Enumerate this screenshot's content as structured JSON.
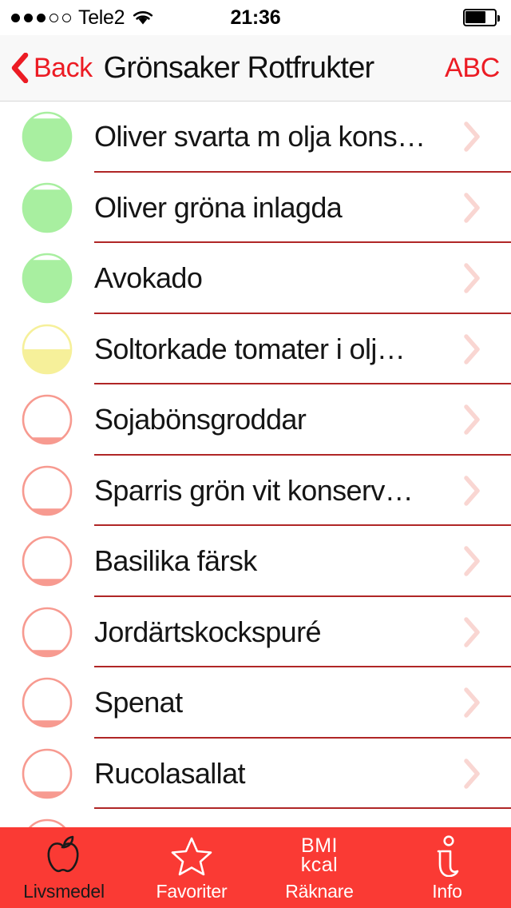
{
  "status_bar": {
    "signal_dots_filled": 3,
    "signal_dots_total": 5,
    "carrier": "Tele2",
    "wifi_icon": "wifi-icon",
    "time": "21:36",
    "battery_percent": 70,
    "battery_icon": "battery-icon"
  },
  "nav_bar": {
    "back_icon": "chevron-left-icon",
    "back_label": "Back",
    "title": "Grönsaker Rotfrukter",
    "right_button_label": "ABC"
  },
  "colors": {
    "tab_bar_red": "#FA3A34",
    "accent_red": "#EC1C24",
    "separator_red": "#B02626",
    "gauge_green": "#A8EFA0",
    "gauge_yellow": "#F6F09A",
    "gauge_pink": "#F79A90",
    "chevron_pink": "#F9D6D2",
    "active_tab_label": "#1A1A1A"
  },
  "list": {
    "chevron_icon": "chevron-right-icon",
    "gauge_icon": "fill-gauge-icon",
    "items": [
      {
        "label": "Oliver svarta m olja kons…",
        "gauge_color": "#A8EFA0",
        "gauge_fill": 88
      },
      {
        "label": "Oliver gröna inlagda",
        "gauge_color": "#A8EFA0",
        "gauge_fill": 88
      },
      {
        "label": "Avokado",
        "gauge_color": "#A8EFA0",
        "gauge_fill": 88
      },
      {
        "label": "Soltorkade tomater i olj…",
        "gauge_color": "#F6F09A",
        "gauge_fill": 50
      },
      {
        "label": "Sojabönsgroddar",
        "gauge_color": "#F79A90",
        "gauge_fill": 13
      },
      {
        "label": "Sparris grön vit konserv…",
        "gauge_color": "#F79A90",
        "gauge_fill": 13
      },
      {
        "label": "Basilika färsk",
        "gauge_color": "#F79A90",
        "gauge_fill": 13
      },
      {
        "label": "Jordärtskockspuré",
        "gauge_color": "#F79A90",
        "gauge_fill": 13
      },
      {
        "label": "Spenat",
        "gauge_color": "#F79A90",
        "gauge_fill": 13
      },
      {
        "label": "Rucolasallat",
        "gauge_color": "#F79A90",
        "gauge_fill": 13
      },
      {
        "label": "",
        "gauge_color": "#F79A90",
        "gauge_fill": 13
      }
    ]
  },
  "tab_bar": {
    "tabs": [
      {
        "label": "Livsmedel",
        "icon": "apple-icon",
        "active": true
      },
      {
        "label": "Favoriter",
        "icon": "star-icon",
        "active": false
      },
      {
        "label": "Räknare",
        "icon": "bmi-kcal-icon",
        "active": false,
        "icon_line1": "BMI",
        "icon_line2": "kcal"
      },
      {
        "label": "Info",
        "icon": "info-icon",
        "active": false
      }
    ]
  }
}
